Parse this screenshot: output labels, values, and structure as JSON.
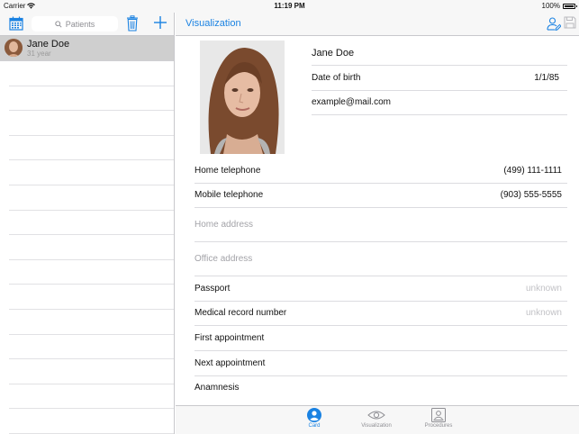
{
  "status": {
    "carrier": "Carrier",
    "time": "11:19 PM",
    "battery": "100%"
  },
  "left": {
    "search_placeholder": "Patients",
    "patients": [
      {
        "name": "Jane Doe",
        "age": "31 year"
      }
    ]
  },
  "right": {
    "title": "Visualization",
    "profile": {
      "name": "Jane Doe",
      "dob_label": "Date of birth",
      "dob_value": "1/1/85",
      "email": "example@mail.com"
    },
    "fields": {
      "home_phone_label": "Home telephone",
      "home_phone_value": "(499) 111-1111",
      "mobile_phone_label": "Mobile telephone",
      "mobile_phone_value": "(903) 555-5555",
      "home_address_placeholder": "Home address",
      "office_address_placeholder": "Office address",
      "passport_label": "Passport",
      "passport_value": "unknown",
      "mrn_label": "Medical record number",
      "mrn_value": "unknown",
      "first_appt_label": "First appointment",
      "next_appt_label": "Next appointment",
      "anamnesis_label": "Anamnesis"
    }
  },
  "tabs": [
    {
      "label": "Card",
      "icon": "person-circle-icon",
      "active": true
    },
    {
      "label": "Visualization",
      "icon": "eye-icon",
      "active": false
    },
    {
      "label": "Procedures",
      "icon": "id-card-icon",
      "active": false
    }
  ],
  "colors": {
    "accent": "#1a82e2",
    "selected_row": "#cfcfcf"
  }
}
